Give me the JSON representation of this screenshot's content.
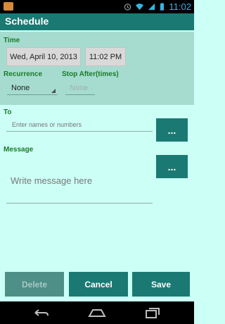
{
  "status_bar": {
    "time": "11:02"
  },
  "app_bar": {
    "title": "Schedule"
  },
  "time_section": {
    "label": "Time",
    "date_button": "Wed, April 10, 2013",
    "time_button": "11:02 PM"
  },
  "recurrence": {
    "label": "Recurrence",
    "value": "None"
  },
  "stop_after": {
    "label": "Stop After(times)",
    "placeholder": "None"
  },
  "to": {
    "label": "To",
    "placeholder": "Enter names or numbers",
    "picker_label": "..."
  },
  "message": {
    "label": "Message",
    "placeholder": "Write message here",
    "picker_label": "..."
  },
  "actions": {
    "delete_label": "Delete",
    "cancel_label": "Cancel",
    "save_label": "Save"
  }
}
